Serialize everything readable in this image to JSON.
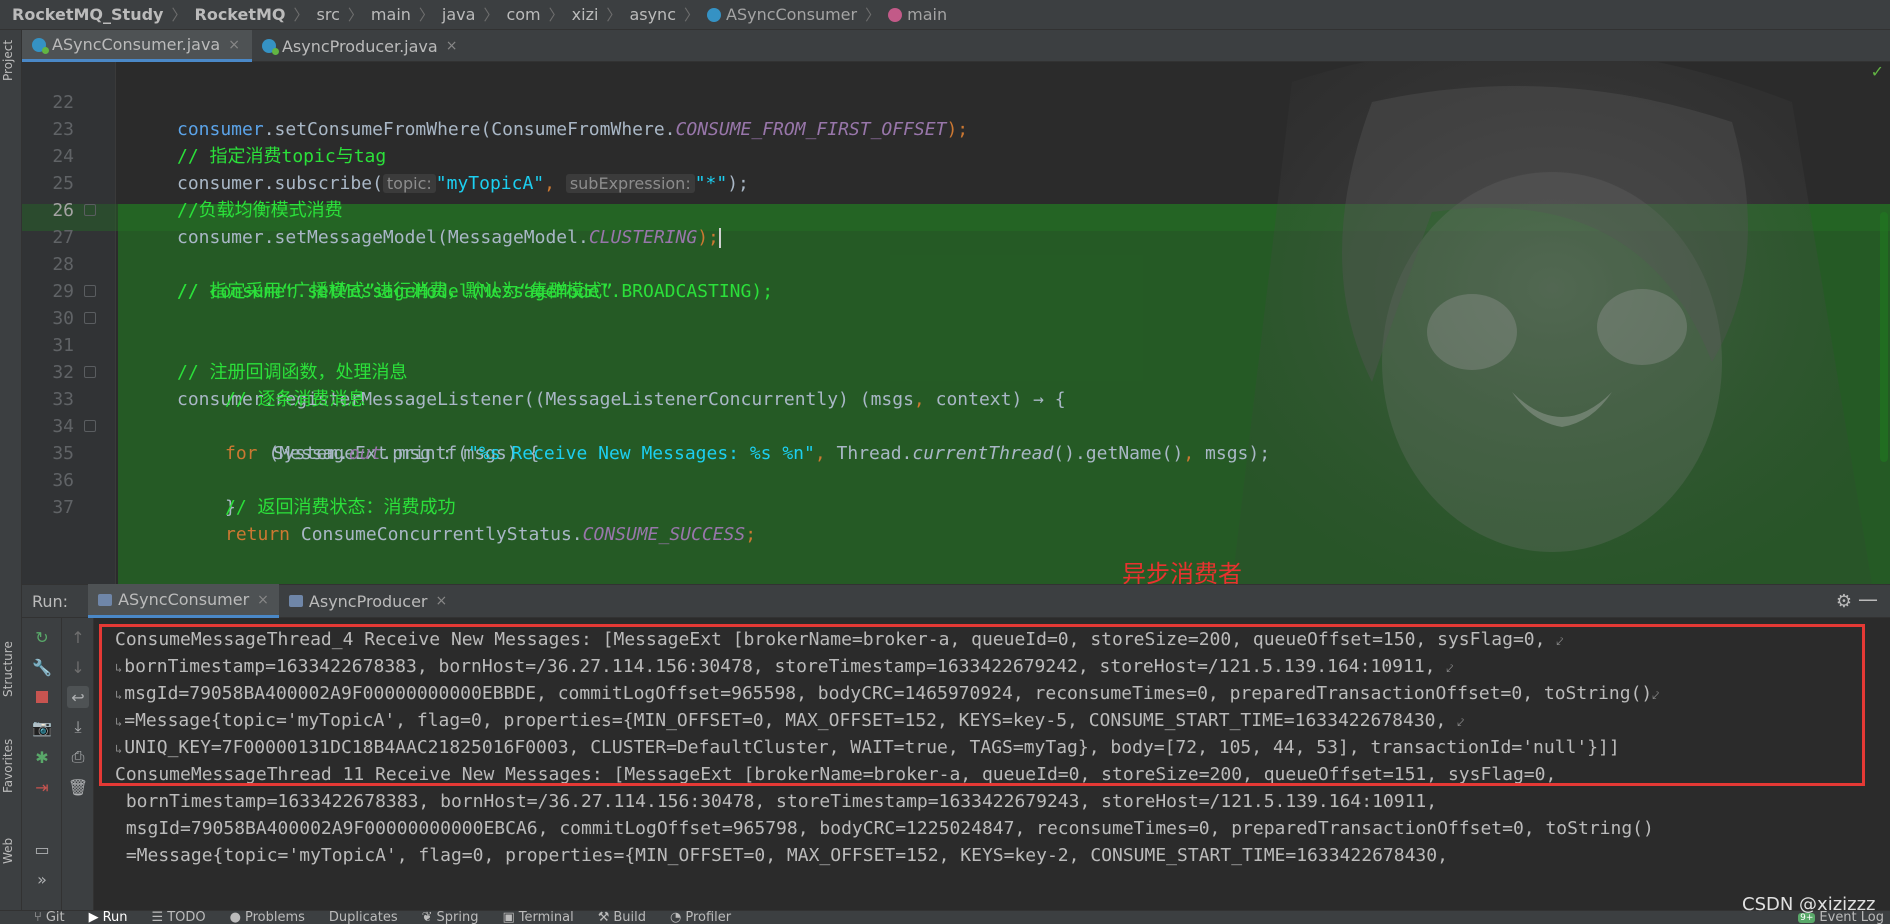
{
  "breadcrumb": {
    "project": "RocketMQ_Study",
    "module": "RocketMQ",
    "path": [
      "src",
      "main",
      "java",
      "com",
      "xizi",
      "async"
    ],
    "class_name": "ASyncConsumer",
    "method_name": "main"
  },
  "left_tools": {
    "project": "Project",
    "structure": "Structure",
    "favorites": "Favorites",
    "web": "Web"
  },
  "editor_tabs": [
    {
      "label": "ASyncConsumer.java",
      "active": true
    },
    {
      "label": "AsyncProducer.java",
      "active": false
    }
  ],
  "editor": {
    "current_line": "26",
    "line_numbers": [
      "22",
      "23",
      "24",
      "25",
      "26",
      "27",
      "28",
      "29",
      "30",
      "31",
      "32",
      "33",
      "34",
      "35",
      "36",
      "37"
    ],
    "code": {
      "l22": {
        "a": "consumer",
        "b": ".setConsumeFromWhere(ConsumeFromWhere.",
        "c": "CONSUME_FROM_FIRST_OFFSET",
        "d": ");"
      },
      "l23": {
        "a": "// 指定消费topic与tag"
      },
      "l24": {
        "a": "consumer.subscribe(",
        "hint1": "topic:",
        "s1": "\"myTopicA\"",
        "comma": ",",
        "hint2": "subExpression:",
        "s2": "\"*\"",
        "end": ");"
      },
      "l25": {
        "a": "//负载均衡模式消费"
      },
      "l26": {
        "a": "consumer.setMessageModel(MessageModel.",
        "b": "CLUSTERING",
        "c": ");"
      },
      "l27": {
        "a": "// 指定采用“广播模式”进行消费，默认为“集群模式”"
      },
      "l28": {
        "a": "// consumer.setMessageModel(MessageModel.BROADCASTING);"
      },
      "l30": {
        "a": "// 注册回调函数，处理消息"
      },
      "l31": {
        "a": "consumer.registerMessageListener((MessageListenerConcurrently) (msgs",
        "b": ",",
        "c": " context) → {"
      },
      "l32": {
        "a": "// 逐条消费消息"
      },
      "l33": {
        "kw": "for",
        "a": " (MessageExt msg : msgs) {"
      },
      "l34": {
        "a": "System.",
        "b": "out",
        "c": ".printf(",
        "s": "\"%s Receive New Messages: %s %n\"",
        "d": ",",
        "e": " Thread.",
        "f": "currentThread",
        "g": "().getName()",
        "h": ",",
        "i": " msgs);"
      },
      "l35": {
        "a": "}"
      },
      "l36": {
        "a": "// 返回消费状态：消费成功"
      },
      "l37": {
        "kw": "return",
        "a": " ConsumeConcurrentlyStatus.",
        "b": "CONSUME_SUCCESS",
        "c": ";"
      }
    }
  },
  "annotation": "异步消费者",
  "run_panel": {
    "label": "Run:",
    "tabs": [
      {
        "label": "ASyncConsumer",
        "active": true
      },
      {
        "label": "AsyncProducer",
        "active": false
      }
    ]
  },
  "console": {
    "lines": [
      "ConsumeMessageThread_4 Receive New Messages: [MessageExt [brokerName=broker-a, queueId=0, storeSize=200, queueOffset=150, sysFlag=0, ",
      "bornTimestamp=1633422678383, bornHost=/36.27.114.156:30478, storeTimestamp=1633422679242, storeHost=/121.5.139.164:10911, ",
      "msgId=79058BA400002A9F00000000000EBBDE, commitLogOffset=965598, bodyCRC=1465970924, reconsumeTimes=0, preparedTransactionOffset=0, toString()",
      "=Message{topic='myTopicA', flag=0, properties={MIN_OFFSET=0, MAX_OFFSET=152, KEYS=key-5, CONSUME_START_TIME=1633422678430, ",
      "UNIQ_KEY=7F00000131DC18B4AAC21825016F0003, CLUSTER=DefaultCluster, WAIT=true, TAGS=myTag}, body=[72, 105, 44, 53], transactionId='null'}]]",
      "ConsumeMessageThread_11 Receive New Messages: [MessageExt [brokerName=broker-a, queueId=0, storeSize=200, queueOffset=151, sysFlag=0,",
      " bornTimestamp=1633422678383, bornHost=/36.27.114.156:30478, storeTimestamp=1633422679243, storeHost=/121.5.139.164:10911,",
      " msgId=79058BA400002A9F00000000000EBCA6, commitLogOffset=965798, bodyCRC=1225024847, reconsumeTimes=0, preparedTransactionOffset=0, toString()",
      " =Message{topic='myTopicA', flag=0, properties={MIN_OFFSET=0, MAX_OFFSET=152, KEYS=key-2, CONSUME_START_TIME=1633422678430,"
    ]
  },
  "bottom_bar": {
    "items": [
      "Git",
      "Run",
      "TODO",
      "Problems",
      "Duplicates",
      "Spring",
      "Terminal",
      "Build",
      "Profiler"
    ],
    "event_log": "Event Log",
    "event_badge": "9+"
  },
  "watermark": "CSDN @xizizzz"
}
